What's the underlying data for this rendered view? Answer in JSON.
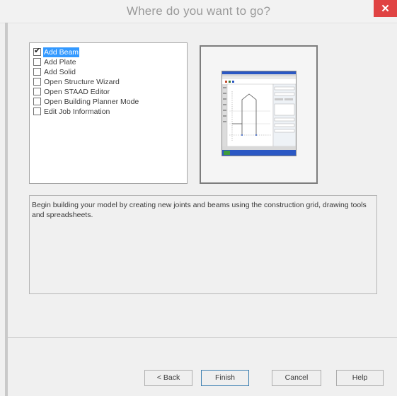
{
  "dialog": {
    "title": "Where do you want to go?",
    "close_glyph": "✕"
  },
  "options": [
    {
      "label": "Add Beam",
      "checked": true,
      "selected": true
    },
    {
      "label": "Add Plate",
      "checked": false,
      "selected": false
    },
    {
      "label": "Add Solid",
      "checked": false,
      "selected": false
    },
    {
      "label": "Open Structure Wizard",
      "checked": false,
      "selected": false
    },
    {
      "label": "Open STAAD Editor",
      "checked": false,
      "selected": false
    },
    {
      "label": "Open Building Planner Mode",
      "checked": false,
      "selected": false
    },
    {
      "label": "Edit Job Information",
      "checked": false,
      "selected": false
    }
  ],
  "description": "Begin building your model by creating new joints and beams using the construction grid, drawing tools and spreadsheets.",
  "buttons": {
    "back": "< Back",
    "finish": "Finish",
    "cancel": "Cancel",
    "help": "Help"
  },
  "colors": {
    "selection": "#3399ff",
    "close": "#e04343",
    "preview_accent": "#2b58c4"
  }
}
